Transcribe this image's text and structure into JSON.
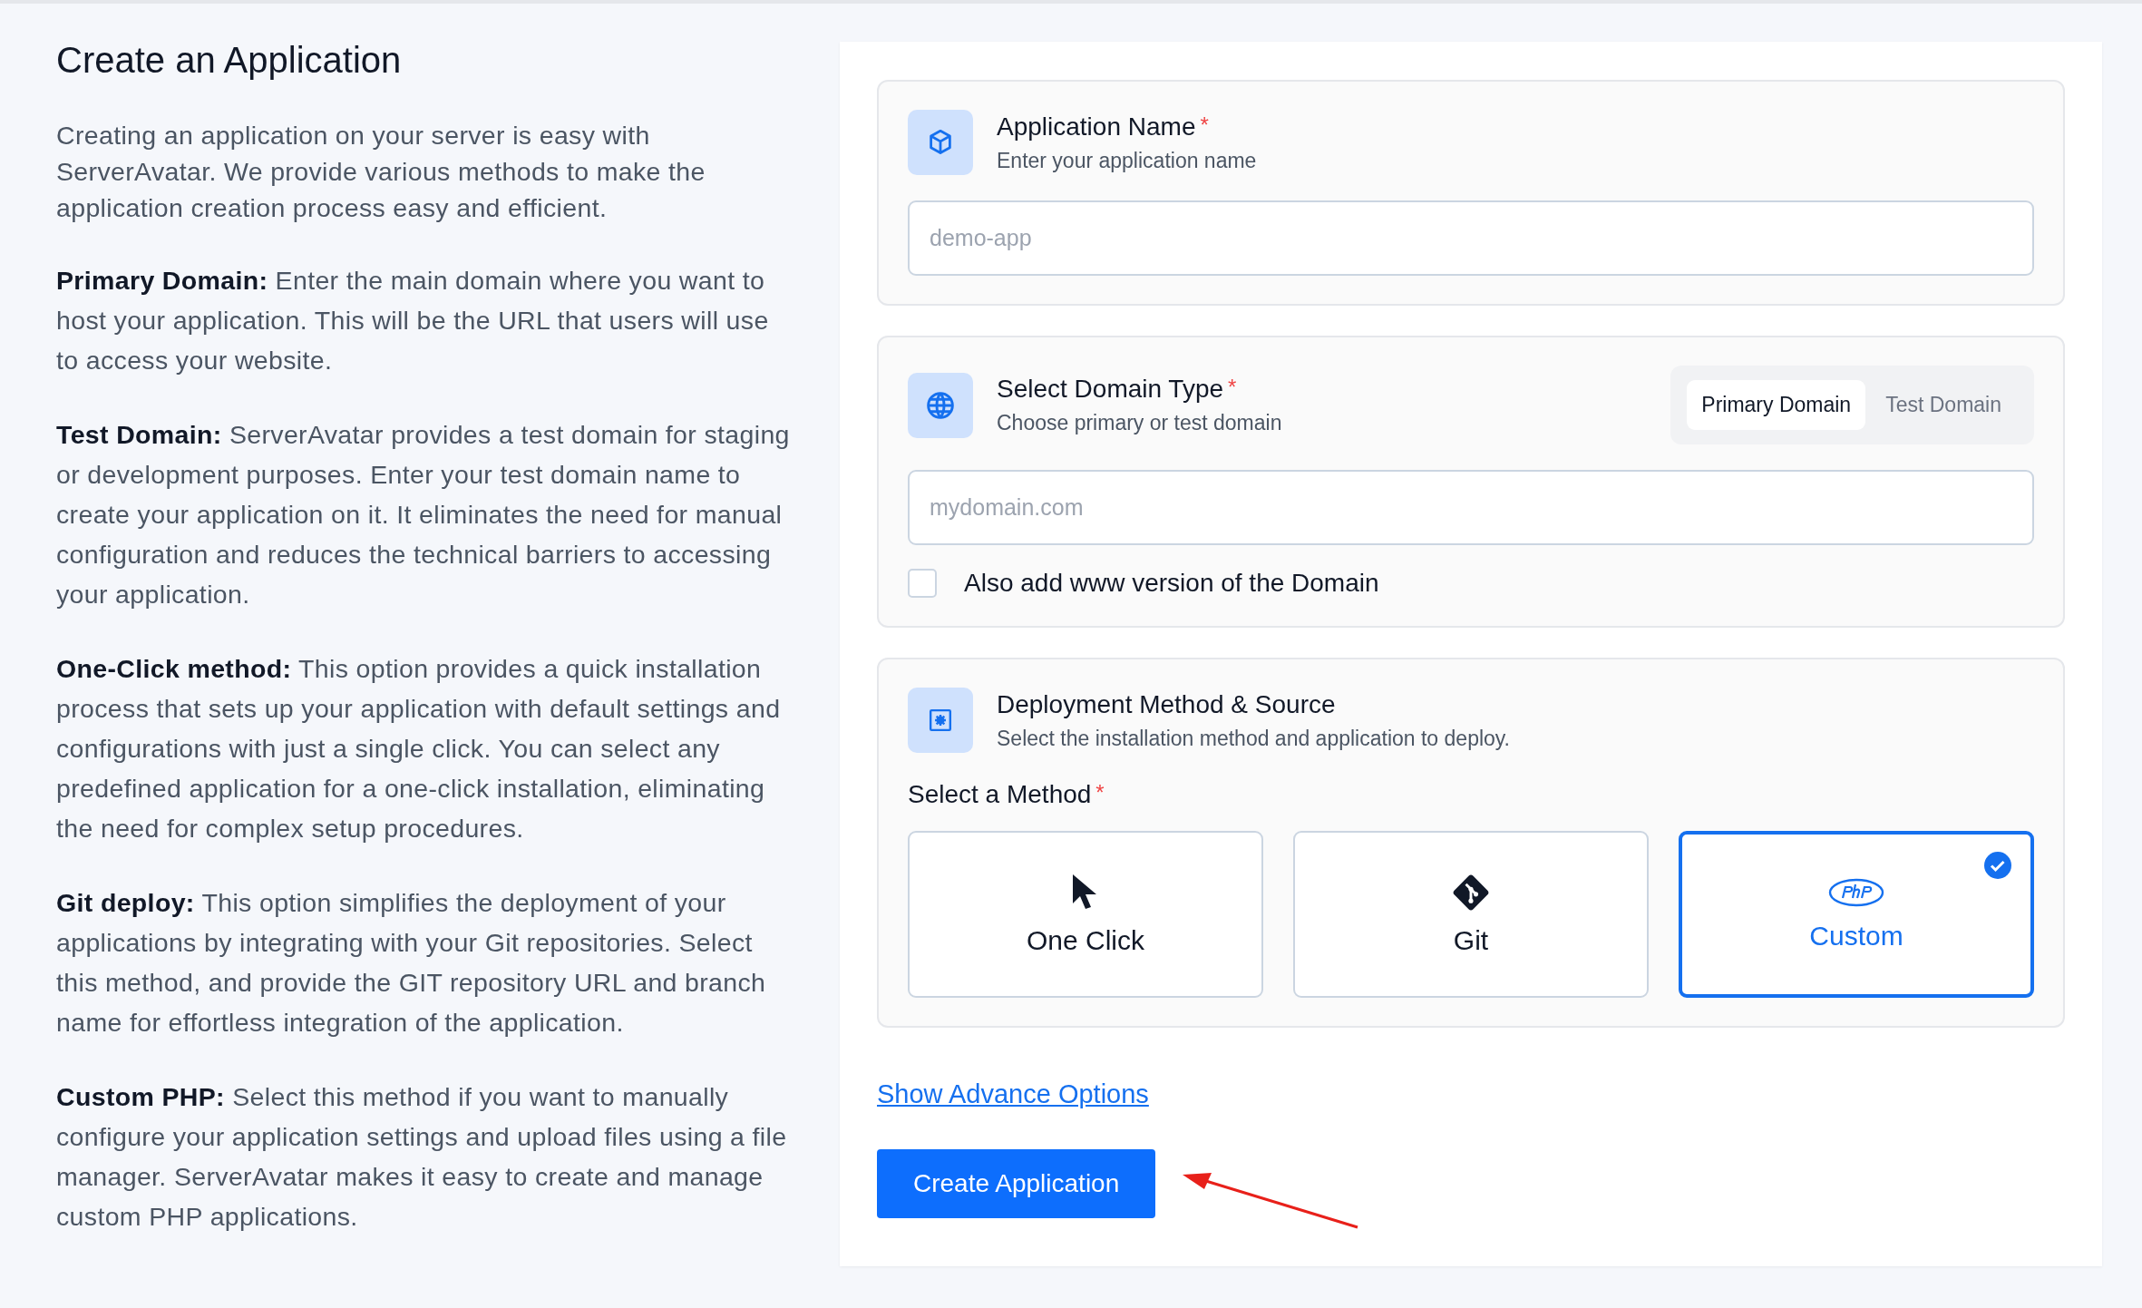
{
  "intro": {
    "title": "Create an Application",
    "paragraphs": [
      "Creating an application on your server is easy with ServerAvatar. We provide various methods to make the application creation process easy and efficient.",
      "**Primary Domain:** Enter the main domain where you want to host your application. This will be the URL that users will use to access your website.",
      "**Test Domain:** ServerAvatar provides a test domain for staging or development purposes. Enter your test domain name to create your application on it. It eliminates the need for manual configuration and reduces the technical barriers to accessing your application.",
      "**One-Click method:** This option provides a quick installation process that sets up your application with default settings and configurations with just a single click. You can select any predefined application for a one-click installation, eliminating the need for complex setup procedures.",
      "**Git deploy:** This option simplifies the deployment of your applications by integrating with your Git repositories. Select this method, and provide the GIT repository URL and branch name for effortless integration of the application.",
      "**Custom PHP:** Select this method if you want to manually configure your application settings and upload files using a file manager. ServerAvatar makes it easy to create and manage custom PHP applications."
    ]
  },
  "form": {
    "sections": [
      {
        "kind": "name",
        "title": "Application Name",
        "required_mark": "*",
        "subtitle": "Enter your application name",
        "input": {
          "placeholder": "demo-app"
        }
      },
      {
        "kind": "domain",
        "title": "Select Domain Type",
        "required_mark": "*",
        "subtitle": "Choose primary or test domain",
        "tabs": [
          {
            "label": "Primary Domain",
            "selected": true
          },
          {
            "label": "Test Domain",
            "selected": false
          }
        ],
        "input": {
          "placeholder": "mydomain.com"
        },
        "checkbox": {
          "label": "Also add www version of the Domain",
          "checked": false
        }
      },
      {
        "kind": "deployment",
        "title": "Deployment Method & Source",
        "subtitle": "Select the installation method and application to deploy.",
        "method_label": "Select a Method",
        "method_required_mark": "*",
        "methods": [
          {
            "kind": "one_click",
            "label": "One Click",
            "selected": false
          },
          {
            "kind": "git",
            "label": "Git",
            "selected": false
          },
          {
            "kind": "php",
            "label": "Custom",
            "selected": true
          }
        ]
      }
    ],
    "advanced_link": "Show Advance Options",
    "submit": "Create Application"
  }
}
